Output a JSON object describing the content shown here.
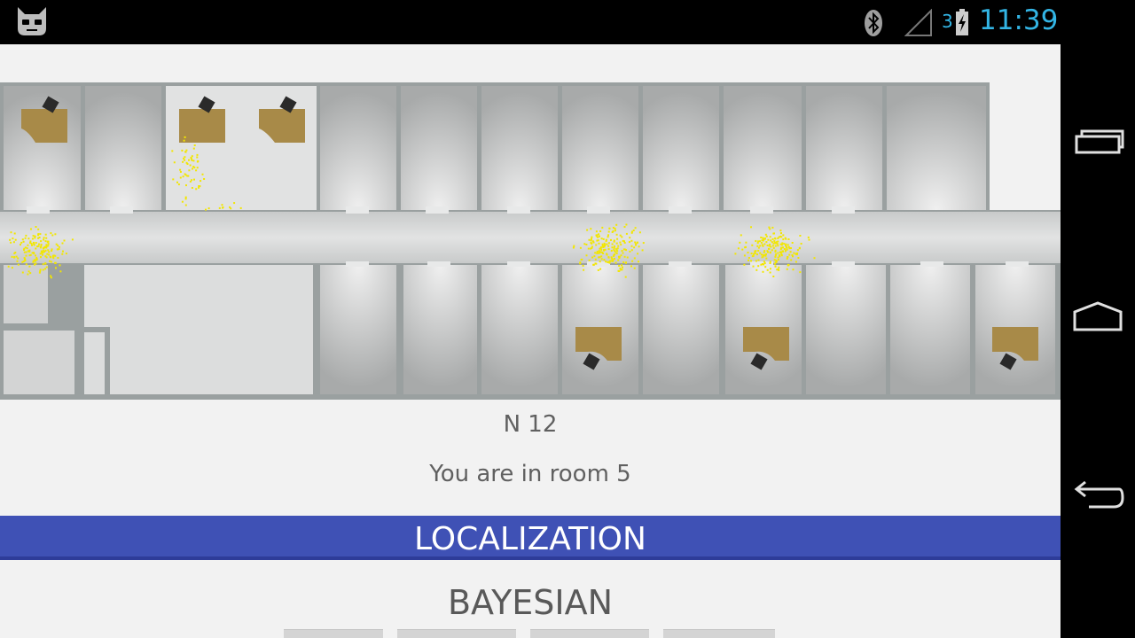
{
  "status_bar": {
    "network_label": "3",
    "time": "11:39",
    "accent_color": "#33b5e5"
  },
  "app": {
    "floor_label": "N 12",
    "room_message": "You are in room 5",
    "localization_label": "LOCALIZATION",
    "method_label": "BAYESIAN",
    "accent_color": "#3f51b5",
    "particle_color": "#f2e600"
  },
  "nav_bar": {
    "icons": [
      "recents-icon",
      "home-icon",
      "back-icon"
    ]
  }
}
